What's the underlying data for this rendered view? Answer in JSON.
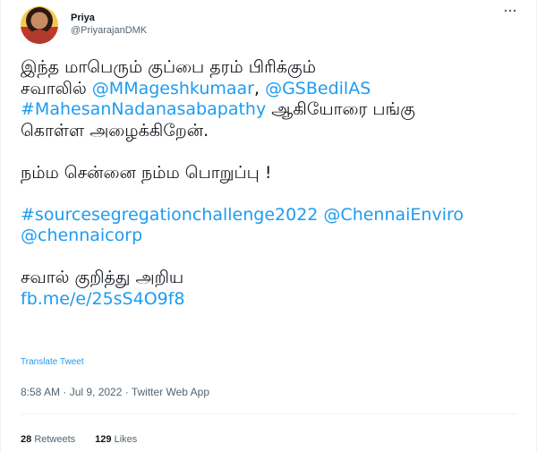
{
  "author": {
    "display_name": "Priya",
    "handle": "@PriyarajanDMK"
  },
  "tweet": {
    "line1": "இந்த மாபெரும் குப்பை தரம் பிரிக்கும்",
    "line2_text": "சவாலில் ",
    "mention1": "@MMageshkumaar",
    "sep": ", ",
    "mention2": "@GSBedilAS",
    "hashtag1": "#MahesanNadanasabapathy",
    "line3_text": " ஆகியோரை  பங்கு",
    "line4": "கொள்ள அழைக்கிறேன்.",
    "line5": "நம்ம சென்னை நம்ம பொறுப்பு !",
    "hashtag2": "#sourcesegregationchallenge2022",
    "space": " ",
    "mention3": "@ChennaiEnviro",
    "mention4": "@chennaicorp",
    "line6": "சவால் குறித்து அறிய",
    "link": "fb.me/e/25sS4O9f8"
  },
  "translate_label": "Translate Tweet",
  "meta": "8:58 AM · Jul 9, 2022 · Twitter Web App",
  "stats": {
    "retweets_count": "28",
    "retweets_label": "Retweets",
    "likes_count": "129",
    "likes_label": "Likes"
  },
  "icons": {
    "more": "more-horizontal-icon"
  },
  "colors": {
    "link": "#1d9bf0",
    "text": "#0f1419",
    "secondary": "#536471"
  }
}
